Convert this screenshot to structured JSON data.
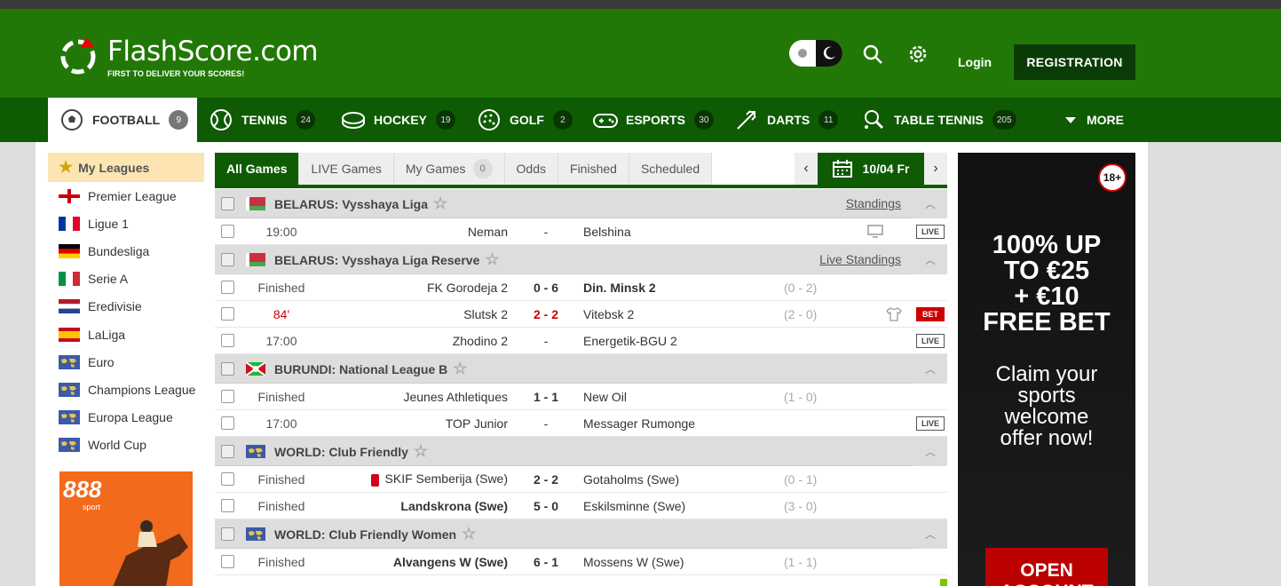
{
  "header": {
    "logo_text": "FlashScore.com",
    "logo_tagline": "FIRST TO DELIVER YOUR SCORES!",
    "login_label": "Login",
    "register_label": "REGISTRATION",
    "brand_color": "#227807"
  },
  "sports": [
    {
      "label": "FOOTBALL",
      "count": "9",
      "icon": "football-icon",
      "active": true
    },
    {
      "label": "TENNIS",
      "count": "24",
      "icon": "tennis-icon"
    },
    {
      "label": "HOCKEY",
      "count": "19",
      "icon": "hockey-icon"
    },
    {
      "label": "GOLF",
      "count": "2",
      "icon": "golf-icon"
    },
    {
      "label": "ESPORTS",
      "count": "30",
      "icon": "esports-icon"
    },
    {
      "label": "DARTS",
      "count": "11",
      "icon": "darts-icon"
    },
    {
      "label": "TABLE TENNIS",
      "count": "205",
      "icon": "table-tennis-icon"
    }
  ],
  "more_label": "MORE",
  "sidebar": {
    "title": "My Leagues",
    "leagues": [
      {
        "label": "Premier League",
        "flag": "england"
      },
      {
        "label": "Ligue 1",
        "flag": "france"
      },
      {
        "label": "Bundesliga",
        "flag": "germany"
      },
      {
        "label": "Serie A",
        "flag": "italy"
      },
      {
        "label": "Eredivisie",
        "flag": "netherlands"
      },
      {
        "label": "LaLiga",
        "flag": "spain"
      },
      {
        "label": "Euro",
        "flag": "world"
      },
      {
        "label": "Champions League",
        "flag": "world"
      },
      {
        "label": "Europa League",
        "flag": "world"
      },
      {
        "label": "World Cup",
        "flag": "world"
      }
    ],
    "ad_brand": "888",
    "ad_sub": "sport"
  },
  "tabs": {
    "all": "All Games",
    "live": "LIVE Games",
    "my": "My Games",
    "my_count": "0",
    "odds": "Odds",
    "finished": "Finished",
    "scheduled": "Scheduled",
    "date": "10/04 Fr"
  },
  "leagues": [
    {
      "name": "BELARUS: Vysshaya Liga",
      "flag": "belarus",
      "standings": "Standings",
      "matches": [
        {
          "time": "19:00",
          "home": "Neman",
          "score": "-",
          "away": "Belshina",
          "half": "",
          "icon": "tv",
          "badge": "LIVE"
        }
      ]
    },
    {
      "name": "BELARUS: Vysshaya Liga Reserve",
      "flag": "belarus",
      "standings": "Live Standings",
      "matches": [
        {
          "time": "Finished",
          "home": "FK Gorodeja 2",
          "score": "0 - 6",
          "away": "Din. Minsk 2",
          "away_bold": true,
          "half": "(0 - 2)",
          "icon": "",
          "badge": ""
        },
        {
          "time": "84'",
          "time_live": true,
          "home": "Slutsk 2",
          "score": "2 - 2",
          "score_live": true,
          "away": "Vitebsk 2",
          "half": "(2 - 0)",
          "icon": "shirt",
          "badge": "BET"
        },
        {
          "time": "17:00",
          "home": "Zhodino 2",
          "score": "-",
          "away": "Energetik-BGU 2",
          "half": "",
          "icon": "",
          "badge": "LIVE"
        }
      ]
    },
    {
      "name": "BURUNDI: National League B",
      "flag": "burundi",
      "standings": "",
      "matches": [
        {
          "time": "Finished",
          "home": "Jeunes Athletiques",
          "score": "1 - 1",
          "away": "New Oil",
          "half": "(1 - 0)",
          "icon": "",
          "badge": ""
        },
        {
          "time": "17:00",
          "home": "TOP Junior",
          "score": "-",
          "away": "Messager Rumonge",
          "half": "",
          "icon": "",
          "badge": "LIVE"
        }
      ]
    },
    {
      "name": "WORLD: Club Friendly",
      "flag": "world",
      "standings": "",
      "matches": [
        {
          "time": "Finished",
          "home": "SKIF Semberija (Swe)",
          "home_redcard": true,
          "score": "2 - 2",
          "away": "Gotaholms (Swe)",
          "half": "(0 - 1)",
          "icon": "",
          "badge": ""
        },
        {
          "time": "Finished",
          "home": "Landskrona (Swe)",
          "home_bold": true,
          "score": "5 - 0",
          "away": "Eskilsminne (Swe)",
          "half": "(3 - 0)",
          "icon": "",
          "badge": ""
        }
      ]
    },
    {
      "name": "WORLD: Club Friendly Women",
      "flag": "world",
      "standings": "",
      "matches": [
        {
          "time": "Finished",
          "home": "Alvangens W (Swe)",
          "home_bold": true,
          "score": "6 - 1",
          "away": "Mossens W (Swe)",
          "half": "(1 - 1)",
          "icon": "",
          "badge": ""
        }
      ]
    }
  ],
  "banner": {
    "age": "18+",
    "line1": "100% UP",
    "line2": "TO €25",
    "line3": "+ €10",
    "line4": "FREE BET",
    "claim1": "Claim your",
    "claim2": "sports",
    "claim3": "welcome",
    "claim4": "offer now!",
    "button": "OPEN ACCOUNT"
  }
}
